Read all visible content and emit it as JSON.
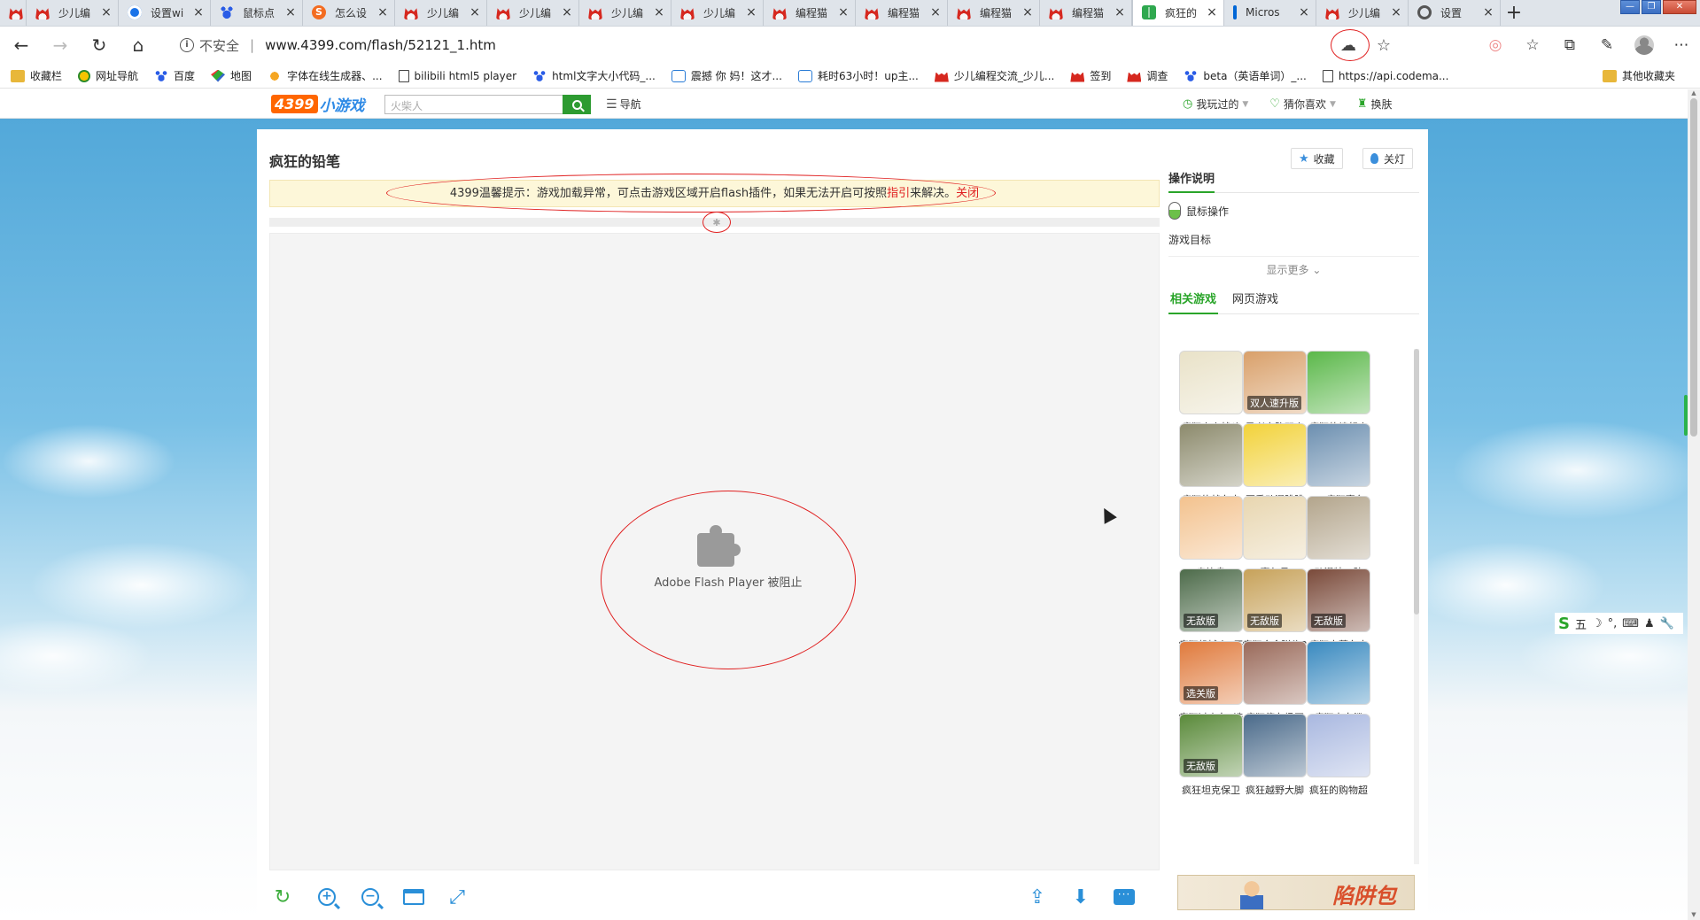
{
  "tabs": [
    {
      "icon": "catface",
      "title": ""
    },
    {
      "icon": "catface",
      "title": "少儿编"
    },
    {
      "icon": "globe",
      "title": "设置wi"
    },
    {
      "icon": "paw",
      "title": "鼠标点"
    },
    {
      "icon": "sogou",
      "title": "怎么设"
    },
    {
      "icon": "catface",
      "title": "少儿编"
    },
    {
      "icon": "catface",
      "title": "少儿编"
    },
    {
      "icon": "catface",
      "title": "少儿编"
    },
    {
      "icon": "catface",
      "title": "少儿编"
    },
    {
      "icon": "catface",
      "title": "编程猫"
    },
    {
      "icon": "catface",
      "title": "编程猫"
    },
    {
      "icon": "catface",
      "title": "编程猫"
    },
    {
      "icon": "catface",
      "title": "编程猫"
    },
    {
      "icon": "grid",
      "title": "疯狂的",
      "active": true
    },
    {
      "icon": "ms",
      "title": "Micros"
    },
    {
      "icon": "catface",
      "title": "少儿编"
    },
    {
      "icon": "gear",
      "title": "设置"
    }
  ],
  "address": {
    "insecure_label": "不安全",
    "url": "www.4399.com/flash/52121_1.htm"
  },
  "favorites": [
    {
      "icon": "folder",
      "label": "收藏栏"
    },
    {
      "icon": "nav",
      "label": "网址导航"
    },
    {
      "icon": "bd",
      "label": "百度"
    },
    {
      "icon": "map",
      "label": "地图"
    },
    {
      "icon": "font",
      "label": "字体在线生成器、..."
    },
    {
      "icon": "page",
      "label": "bilibili html5 player"
    },
    {
      "icon": "bd",
      "label": "html文字大小代码_..."
    },
    {
      "icon": "blog",
      "label": "震撼 你 妈！这才..."
    },
    {
      "icon": "blog",
      "label": "耗时63小时！up主..."
    },
    {
      "icon": "cat",
      "label": "少儿编程交流_少儿..."
    },
    {
      "icon": "cat",
      "label": "签到"
    },
    {
      "icon": "cat",
      "label": "调查"
    },
    {
      "icon": "bd",
      "label": "beta（英语单词）_..."
    },
    {
      "icon": "page",
      "label": "https://api.codema..."
    }
  ],
  "favorites_other": "其他收藏夹",
  "site": {
    "logo_num": "4399",
    "logo_text": "小游戏",
    "search_placeholder": "火柴人",
    "nav_label": "导航",
    "played_label": "我玩过的",
    "guess_label": "猜你喜欢",
    "skin_label": "换肤"
  },
  "game": {
    "title": "疯狂的铅笔",
    "collect_label": "收藏",
    "light_label": "关灯",
    "tip_prefix": "4399温馨提示：游戏加载异常，可点击游戏区域开启flash插件，如果无法开启可按照",
    "tip_link": "指引",
    "tip_suffix": "来解决。",
    "tip_close": "关闭",
    "flash_blocked": "Adobe Flash Player 被阻止"
  },
  "side": {
    "ops_title": "操作说明",
    "mouse_label": "鼠标操作",
    "goal_label": "游戏目标",
    "more_label": "显示更多",
    "tab_related": "相关游戏",
    "tab_web": "网页游戏"
  },
  "related_games": [
    {
      "name": "疯狂小人战斗",
      "badge": "",
      "color": "#e9e2c8"
    },
    {
      "name": "勇者之路双人",
      "badge": "双人速升版",
      "color": "#d9a06a"
    },
    {
      "name": "疯狂的愤怒小",
      "badge": "",
      "color": "#5bb84a"
    },
    {
      "name": "疯狂的战车中",
      "badge": "",
      "color": "#8c8a6c"
    },
    {
      "name": "夏季动漫跳跳",
      "badge": "",
      "color": "#f2d23a"
    },
    {
      "name": "3D疯狂赛车",
      "badge": "",
      "color": "#6c8fb0"
    },
    {
      "name": "奥比岛",
      "badge": "",
      "color": "#f3c28e"
    },
    {
      "name": "赛尔号",
      "badge": "",
      "color": "#e8d6b0"
    },
    {
      "name": "动漫特工队",
      "badge": "",
      "color": "#b3a58c"
    },
    {
      "name": "疯狂机械人2无",
      "badge": "无敌版",
      "color": "#4d6b4a"
    },
    {
      "name": "疯狂合金弹头3",
      "badge": "无敌版",
      "color": "#c7a25a"
    },
    {
      "name": "疯狂古董车大",
      "badge": "无敌版",
      "color": "#7a4a3a"
    },
    {
      "name": "疯狂过山车2选",
      "badge": "选关版",
      "color": "#e07a3c"
    },
    {
      "name": "疯狂停车场正",
      "badge": "",
      "color": "#9a6a5a"
    },
    {
      "name": "疯狂大白鲨",
      "badge": "",
      "color": "#3a8ac0"
    },
    {
      "name": "疯狂坦克保卫",
      "badge": "无敌版",
      "color": "#5a8a3a"
    },
    {
      "name": "疯狂越野大脚",
      "badge": "",
      "color": "#4a6a8a"
    },
    {
      "name": "疯狂的购物超",
      "badge": "",
      "color": "#a9b8e0"
    }
  ],
  "banner_text": "陷阱包"
}
